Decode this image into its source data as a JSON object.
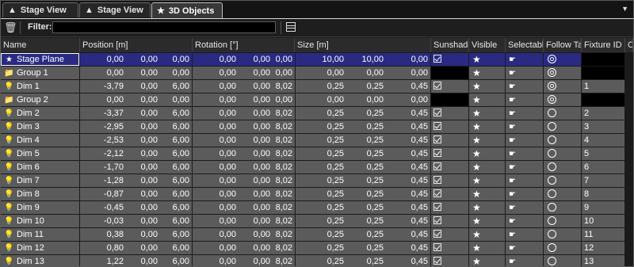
{
  "tabs": [
    {
      "label": "Stage View",
      "icon": "stage-icon",
      "active": false
    },
    {
      "label": "Stage View",
      "icon": "stage-icon",
      "active": false
    },
    {
      "label": "3D Objects",
      "icon": "star-icon",
      "active": true
    }
  ],
  "filter": {
    "label": "Filter:",
    "value": ""
  },
  "columns": [
    "Name",
    "Position  [m]",
    "Rotation  [°]",
    "Size  [m]",
    "Sunshade",
    "Visible",
    "Selectable",
    "Follow Target",
    "Fixture ID",
    "Ch"
  ],
  "rows": [
    {
      "name": "Stage Plane",
      "icon": "star",
      "pos": [
        "0,00",
        "0,00",
        "0,00"
      ],
      "rot": [
        "0,00",
        "0,00",
        "0,00"
      ],
      "size": [
        "10,00",
        "10,00",
        "0,00"
      ],
      "sunshade": true,
      "follow": "target",
      "fid": "",
      "selected": true
    },
    {
      "name": "Group 1",
      "icon": "folder",
      "pos": [
        "0,00",
        "0,00",
        "0,00"
      ],
      "rot": [
        "0,00",
        "0,00",
        "0,00"
      ],
      "size": [
        "0,00",
        "0,00",
        "0,00"
      ],
      "sunshade": false,
      "follow": "target",
      "fid": "",
      "group": true
    },
    {
      "name": "Dim 1",
      "icon": "bulb",
      "pos": [
        "-3,79",
        "0,00",
        "6,00"
      ],
      "rot": [
        "0,00",
        "0,00",
        "8,02"
      ],
      "size": [
        "0,25",
        "0,25",
        "0,45"
      ],
      "sunshade": true,
      "follow": "target",
      "fid": "1"
    },
    {
      "name": "Group 2",
      "icon": "folder",
      "pos": [
        "0,00",
        "0,00",
        "0,00"
      ],
      "rot": [
        "0,00",
        "0,00",
        "0,00"
      ],
      "size": [
        "0,00",
        "0,00",
        "0,00"
      ],
      "sunshade": false,
      "follow": "target",
      "fid": "",
      "group": true
    },
    {
      "name": "Dim 2",
      "icon": "bulb",
      "pos": [
        "-3,37",
        "0,00",
        "6,00"
      ],
      "rot": [
        "0,00",
        "0,00",
        "8,02"
      ],
      "size": [
        "0,25",
        "0,25",
        "0,45"
      ],
      "sunshade": true,
      "follow": "none",
      "fid": "2"
    },
    {
      "name": "Dim 3",
      "icon": "bulb",
      "pos": [
        "-2,95",
        "0,00",
        "6,00"
      ],
      "rot": [
        "0,00",
        "0,00",
        "8,02"
      ],
      "size": [
        "0,25",
        "0,25",
        "0,45"
      ],
      "sunshade": true,
      "follow": "none",
      "fid": "3"
    },
    {
      "name": "Dim 4",
      "icon": "bulb",
      "pos": [
        "-2,53",
        "0,00",
        "6,00"
      ],
      "rot": [
        "0,00",
        "0,00",
        "8,02"
      ],
      "size": [
        "0,25",
        "0,25",
        "0,45"
      ],
      "sunshade": true,
      "follow": "none",
      "fid": "4"
    },
    {
      "name": "Dim 5",
      "icon": "bulb",
      "pos": [
        "-2,12",
        "0,00",
        "6,00"
      ],
      "rot": [
        "0,00",
        "0,00",
        "8,02"
      ],
      "size": [
        "0,25",
        "0,25",
        "0,45"
      ],
      "sunshade": true,
      "follow": "none",
      "fid": "5"
    },
    {
      "name": "Dim 6",
      "icon": "bulb",
      "pos": [
        "-1,70",
        "0,00",
        "6,00"
      ],
      "rot": [
        "0,00",
        "0,00",
        "8,02"
      ],
      "size": [
        "0,25",
        "0,25",
        "0,45"
      ],
      "sunshade": true,
      "follow": "none",
      "fid": "6"
    },
    {
      "name": "Dim 7",
      "icon": "bulb",
      "pos": [
        "-1,28",
        "0,00",
        "6,00"
      ],
      "rot": [
        "0,00",
        "0,00",
        "8,02"
      ],
      "size": [
        "0,25",
        "0,25",
        "0,45"
      ],
      "sunshade": true,
      "follow": "none",
      "fid": "7"
    },
    {
      "name": "Dim 8",
      "icon": "bulb",
      "pos": [
        "-0,87",
        "0,00",
        "6,00"
      ],
      "rot": [
        "0,00",
        "0,00",
        "8,02"
      ],
      "size": [
        "0,25",
        "0,25",
        "0,45"
      ],
      "sunshade": true,
      "follow": "none",
      "fid": "8"
    },
    {
      "name": "Dim 9",
      "icon": "bulb",
      "pos": [
        "-0,45",
        "0,00",
        "6,00"
      ],
      "rot": [
        "0,00",
        "0,00",
        "8,02"
      ],
      "size": [
        "0,25",
        "0,25",
        "0,45"
      ],
      "sunshade": true,
      "follow": "none",
      "fid": "9"
    },
    {
      "name": "Dim 10",
      "icon": "bulb",
      "pos": [
        "-0,03",
        "0,00",
        "6,00"
      ],
      "rot": [
        "0,00",
        "0,00",
        "8,02"
      ],
      "size": [
        "0,25",
        "0,25",
        "0,45"
      ],
      "sunshade": true,
      "follow": "none",
      "fid": "10"
    },
    {
      "name": "Dim 11",
      "icon": "bulb",
      "pos": [
        "0,38",
        "0,00",
        "6,00"
      ],
      "rot": [
        "0,00",
        "0,00",
        "8,02"
      ],
      "size": [
        "0,25",
        "0,25",
        "0,45"
      ],
      "sunshade": true,
      "follow": "none",
      "fid": "11"
    },
    {
      "name": "Dim 12",
      "icon": "bulb",
      "pos": [
        "0,80",
        "0,00",
        "6,00"
      ],
      "rot": [
        "0,00",
        "0,00",
        "8,02"
      ],
      "size": [
        "0,25",
        "0,25",
        "0,45"
      ],
      "sunshade": true,
      "follow": "none",
      "fid": "12"
    },
    {
      "name": "Dim 13",
      "icon": "bulb",
      "pos": [
        "1,22",
        "0,00",
        "6,00"
      ],
      "rot": [
        "0,00",
        "0,00",
        "8,02"
      ],
      "size": [
        "0,25",
        "0,25",
        "0,45"
      ],
      "sunshade": true,
      "follow": "none",
      "fid": "13"
    }
  ],
  "colors": {
    "row": "#5b5b5b",
    "selected": "#2a2a82",
    "empty": "#000000"
  }
}
